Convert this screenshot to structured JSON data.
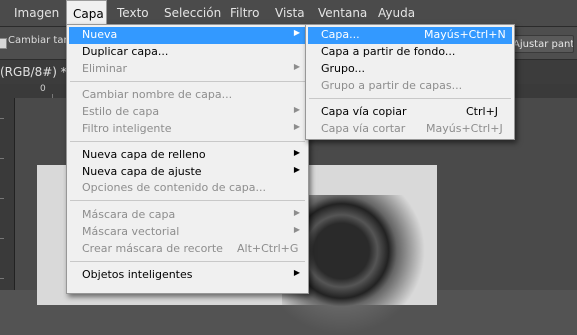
{
  "menubar": {
    "items": [
      "Imagen",
      "Capa",
      "Texto",
      "Selección",
      "Filtro",
      "Vista",
      "Ventana",
      "Ayuda"
    ]
  },
  "options_bar": {
    "checkbox_label": "Cambiar tama",
    "button_label": "Ajustar pant."
  },
  "document": {
    "tab_title": "(RGB/8#) *",
    "ruler_zero": "0"
  },
  "layer_menu": {
    "items": [
      {
        "label": "Nueva",
        "submenu": true,
        "selected": true
      },
      {
        "label": "Duplicar capa...",
        "enabled": true
      },
      {
        "label": "Eliminar",
        "submenu": true,
        "enabled": false
      },
      {
        "label": "Cambiar nombre de capa...",
        "enabled": false
      },
      {
        "label": "Estilo de capa",
        "submenu": true,
        "enabled": false
      },
      {
        "label": "Filtro inteligente",
        "submenu": true,
        "enabled": false
      },
      {
        "label": "Nueva capa de relleno",
        "submenu": true,
        "enabled": true
      },
      {
        "label": "Nueva capa de ajuste",
        "submenu": true,
        "enabled": true
      },
      {
        "label": "Opciones de contenido de capa...",
        "enabled": false
      },
      {
        "label": "Máscara de capa",
        "submenu": true,
        "enabled": false
      },
      {
        "label": "Máscara vectorial",
        "submenu": true,
        "enabled": false
      },
      {
        "label": "Crear máscara de recorte",
        "shortcut": "Alt+Ctrl+G",
        "enabled": false
      },
      {
        "label": "Objetos inteligentes",
        "submenu": true,
        "enabled": true
      }
    ]
  },
  "new_submenu": {
    "items": [
      {
        "label": "Capa...",
        "shortcut": "Mayús+Ctrl+N",
        "selected": true
      },
      {
        "label": "Capa a partir de fondo...",
        "enabled": true
      },
      {
        "label": "Grupo...",
        "enabled": true
      },
      {
        "label": "Grupo a partir de capas...",
        "enabled": false
      },
      {
        "label": "Capa vía copiar",
        "shortcut": "Ctrl+J",
        "enabled": true
      },
      {
        "label": "Capa vía cortar",
        "shortcut": "Mayús+Ctrl+J",
        "enabled": false
      }
    ]
  },
  "colors": {
    "menu_highlight": "#3399ff",
    "menu_background": "#f0f0f0",
    "disabled_text": "#8d8d8d",
    "app_background": "#535353"
  }
}
